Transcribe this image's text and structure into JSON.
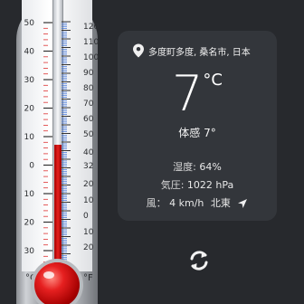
{
  "thermometer": {
    "celsius_unit": "°C",
    "fahrenheit_unit": "°F",
    "celsius_ticks": [
      "50",
      "40",
      "30",
      "20",
      "10",
      "0",
      "10",
      "20",
      "30"
    ],
    "fahrenheit_ticks": [
      "120",
      "110",
      "100",
      "90",
      "80",
      "70",
      "60",
      "50",
      "40",
      "32",
      "20",
      "10",
      "0",
      "10",
      "20"
    ],
    "current_celsius": 7
  },
  "weather": {
    "location": "多度町多度, 桑名市, 日本",
    "temperature": "7",
    "temperature_unit": "°C",
    "feels_like": "体感 7°",
    "humidity_label": "湿度: ",
    "humidity_value": "64%",
    "pressure_label": "気圧: ",
    "pressure_value": "1022 hPa",
    "wind_label": "風： ",
    "wind_value": "4 km/h",
    "wind_direction": "北東"
  },
  "icons": {
    "location": "location-pin-icon",
    "wind_direction": "navigation-arrow-icon",
    "refresh": "refresh-icon"
  },
  "colors": {
    "background": "#27292d",
    "card": "#33363b",
    "mercury": "#e5201e"
  }
}
